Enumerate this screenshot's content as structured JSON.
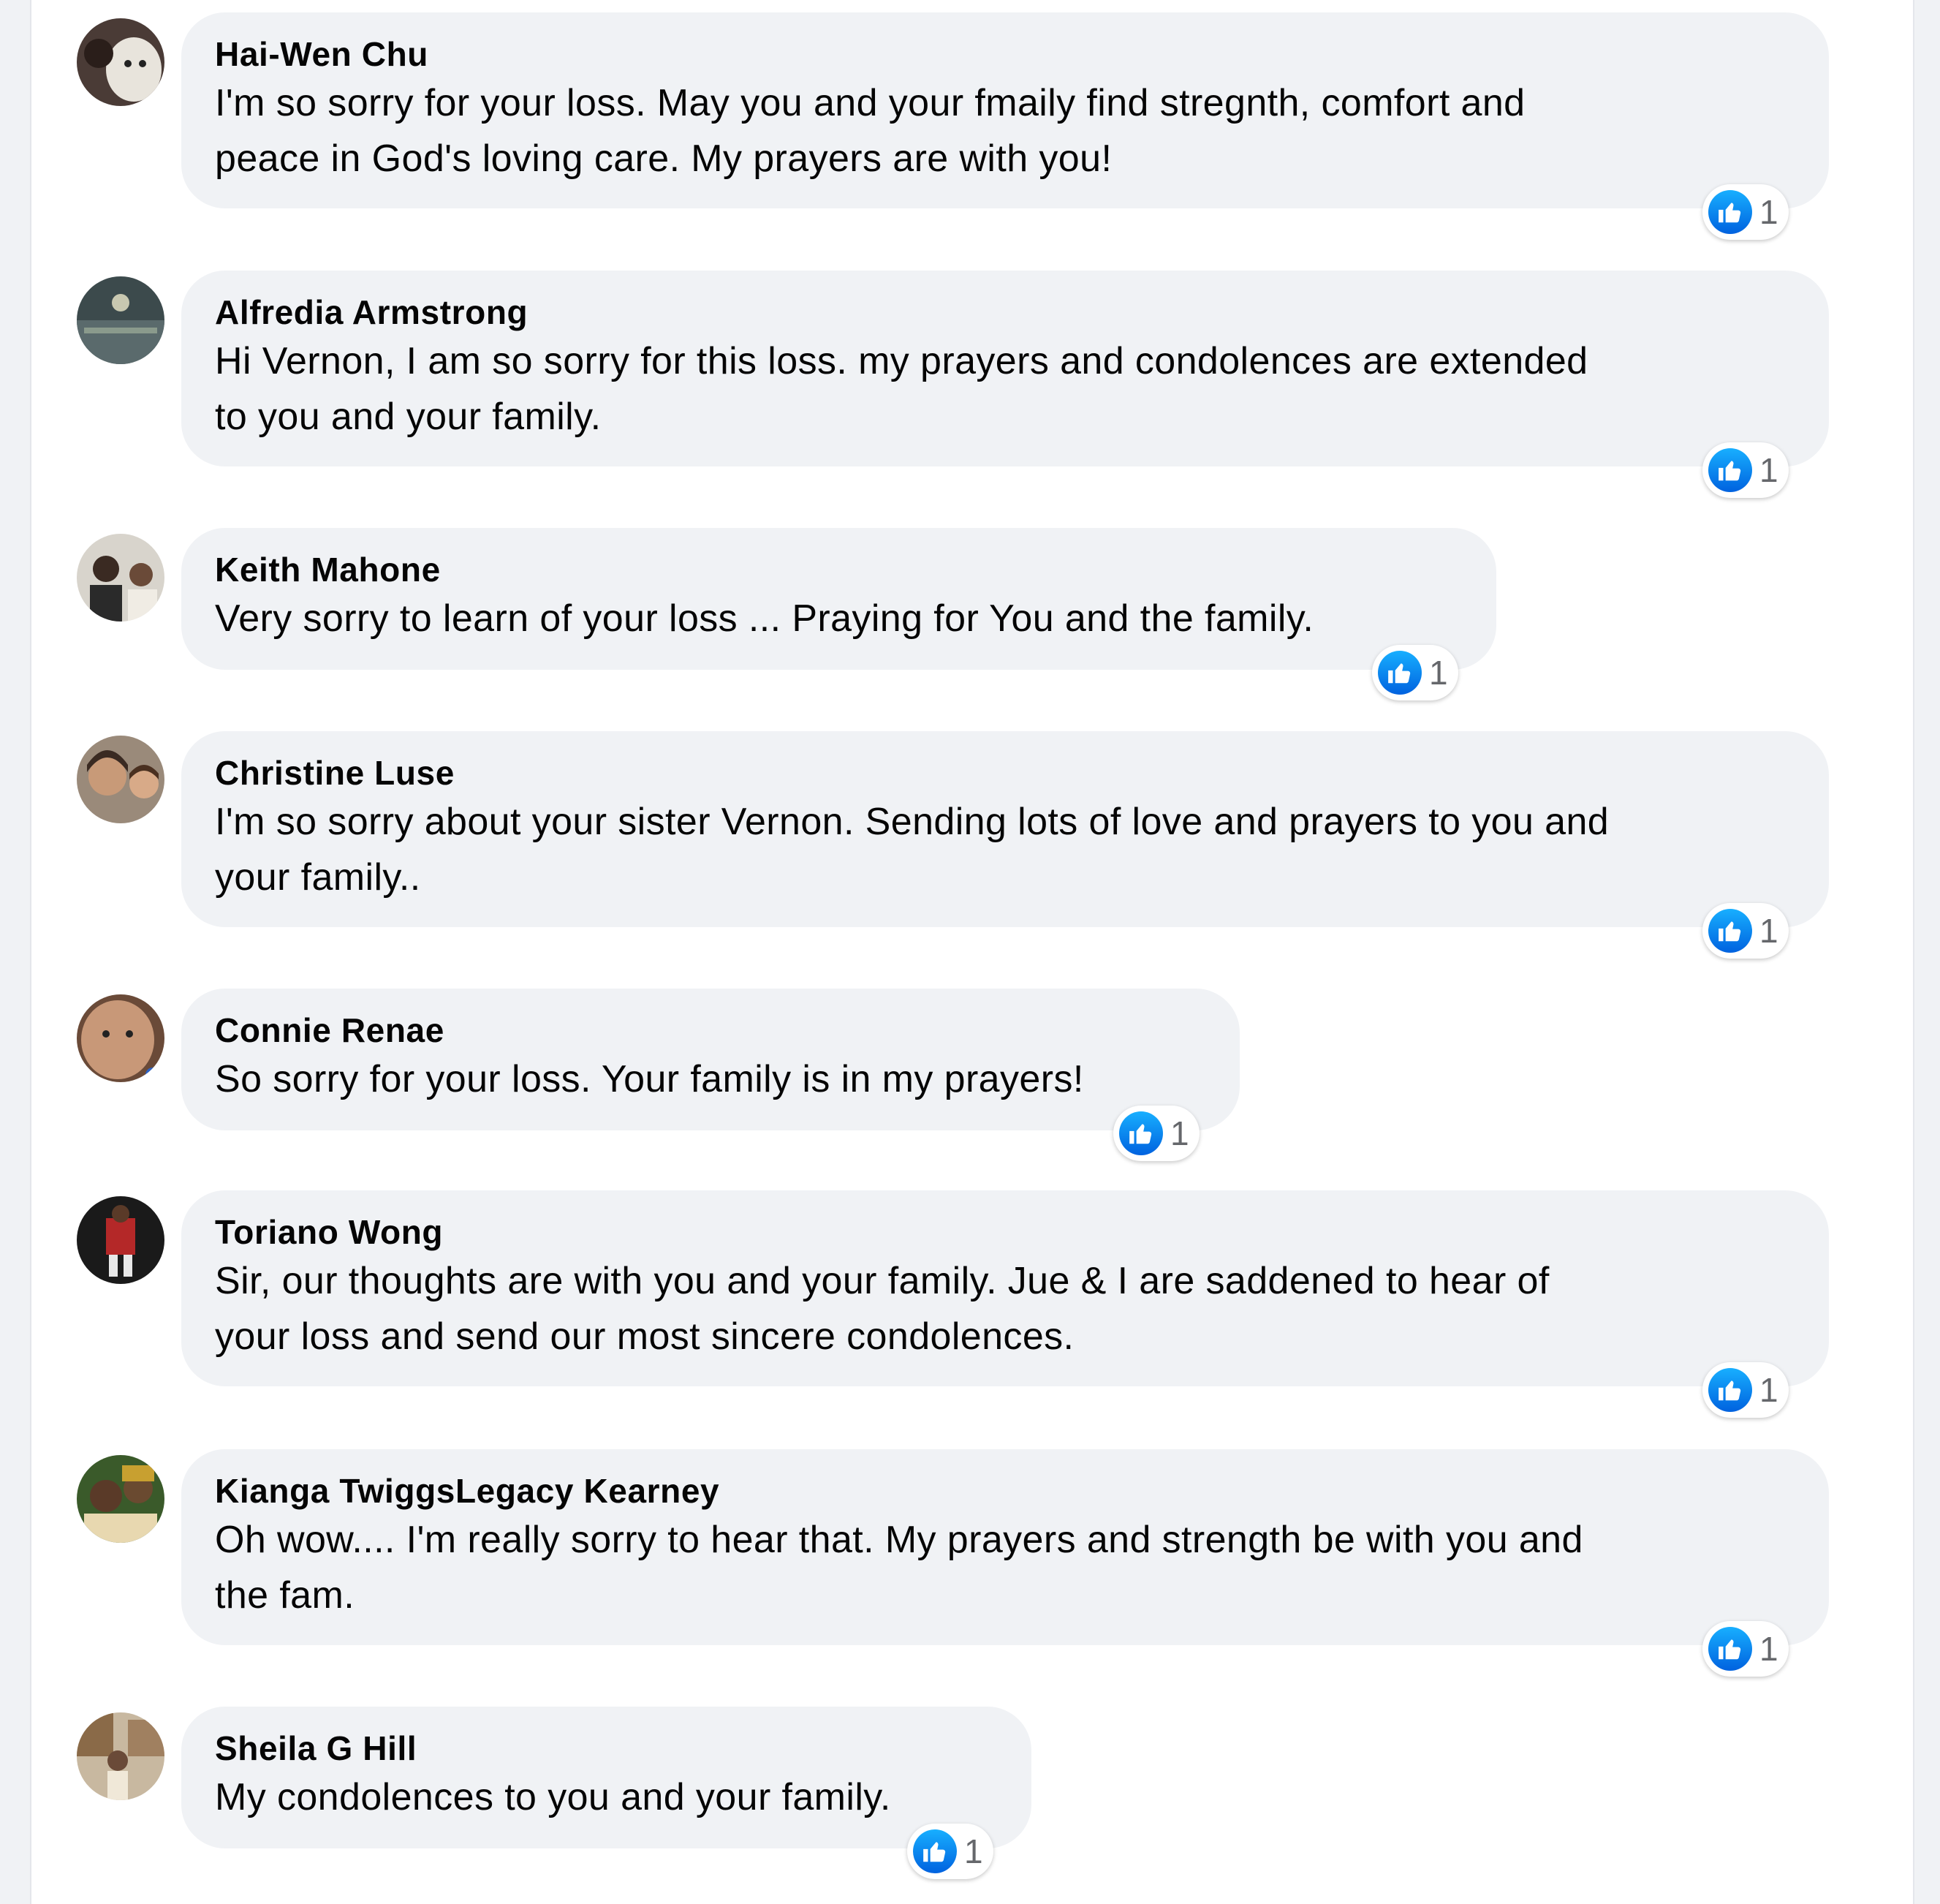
{
  "comments": [
    {
      "author": "Hai-Wen Chu",
      "lines": [
        "I'm so sorry for your loss. May you and your fmaily find stregnth, comfort and",
        "peace in God's loving care. My prayers are with you!"
      ],
      "reaction_count": "1",
      "avatar_colors": [
        "#4a3b36",
        "#e8e4dc"
      ]
    },
    {
      "author": "Alfredia Armstrong",
      "lines": [
        "Hi Vernon, I am so sorry for this loss. my prayers and condolences are extended",
        "to you and your family."
      ],
      "reaction_count": "1",
      "avatar_colors": [
        "#3c4a4c",
        "#8a9a8c"
      ]
    },
    {
      "author": "Keith Mahone",
      "lines": [
        "Very sorry to learn of your loss ... Praying for You and the family."
      ],
      "reaction_count": "1",
      "avatar_colors": [
        "#d8d4cc",
        "#3a2a22"
      ]
    },
    {
      "author": "Christine Luse",
      "lines": [
        "I'm so sorry about your sister Vernon. Sending lots of love and prayers to you and",
        "your family.."
      ],
      "reaction_count": "1",
      "avatar_colors": [
        "#9a8a7a",
        "#c89a78"
      ]
    },
    {
      "author": "Connie Renae",
      "lines": [
        "So sorry for your loss. Your family is in my prayers!"
      ],
      "reaction_count": "1",
      "avatar_colors": [
        "#c89878",
        "#6a4a38"
      ]
    },
    {
      "author": "Toriano Wong",
      "lines": [
        "Sir, our thoughts are with you and your family. Jue & I are saddened to hear of",
        "your loss and send our most sincere condolences."
      ],
      "reaction_count": "1",
      "avatar_colors": [
        "#1a1a1a",
        "#b42828"
      ]
    },
    {
      "author": "Kianga TwiggsLegacy Kearney",
      "lines": [
        "Oh wow.... I'm really sorry to hear that. My prayers and strength be with you and",
        "the fam."
      ],
      "reaction_count": "1",
      "avatar_colors": [
        "#3a5a2a",
        "#c8a030"
      ]
    },
    {
      "author": "Sheila G Hill",
      "lines": [
        "My condolences to you and your family."
      ],
      "reaction_count": "1",
      "avatar_colors": [
        "#c8b8a0",
        "#6a4a38"
      ]
    }
  ],
  "colors": {
    "bubble": "#f0f2f5",
    "like_blue": "#1877f2",
    "text": "#050505",
    "count": "#65676b"
  },
  "icons": {
    "reaction": "like-thumbs-up-icon"
  }
}
